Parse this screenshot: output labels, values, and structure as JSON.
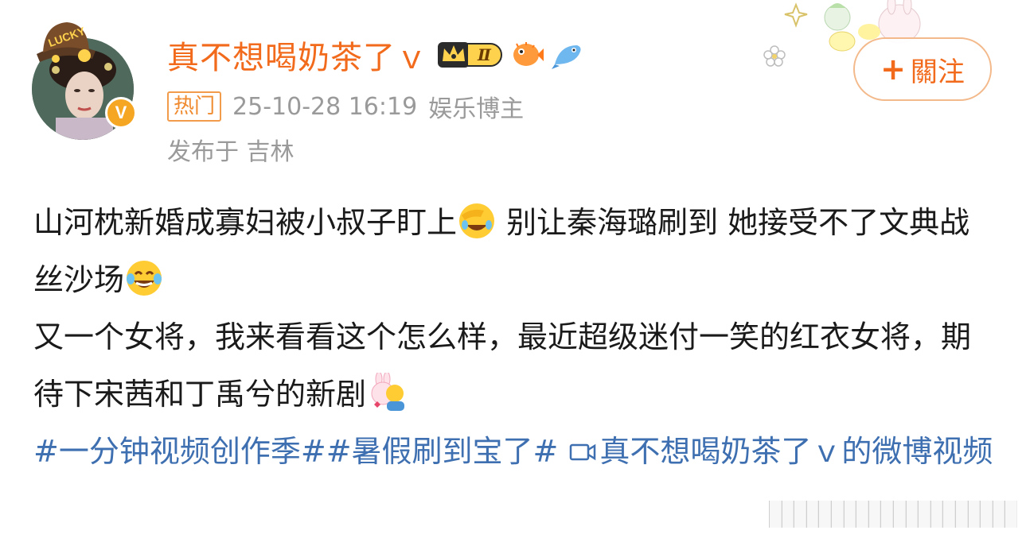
{
  "profile": {
    "username": "真不想喝奶茶了ｖ",
    "vip_level": "Ⅱ",
    "verified_mark": "V",
    "hat_text": "LUCKY",
    "hot_tag": "热门",
    "timestamp": "25-10-28 16:19",
    "category": "娱乐博主",
    "location": "发布于 吉林"
  },
  "actions": {
    "follow_plus": "+",
    "follow_label": "關注"
  },
  "post": {
    "line1_a": "山河枕新婚成寡妇被小叔子盯上",
    "line1_b": " 别让秦海璐刷到 她接受不了文典战丝沙场",
    "line2": "又一个女将，我来看看这个怎么样，最近超级迷付一笑的红衣女将，期待下宋茜和丁禹兮的新剧",
    "hashtags": [
      "#一分钟视频创作季#",
      "#暑假刷到宝了#"
    ],
    "video_link": "真不想喝奶茶了ｖ的微博视频"
  },
  "colors": {
    "username": "#f26a1b",
    "link": "#3e6fb0",
    "meta": "#9a9a9a",
    "hot_tag": "#f08a2e"
  },
  "icons": [
    "lucky-hat-icon",
    "verified-icon",
    "crown-icon",
    "pufferfish-icon",
    "blue-fish-icon",
    "facepalm-laugh-emoji",
    "tears-of-joy-emoji",
    "bunny-hug-emoji",
    "video-icon"
  ]
}
